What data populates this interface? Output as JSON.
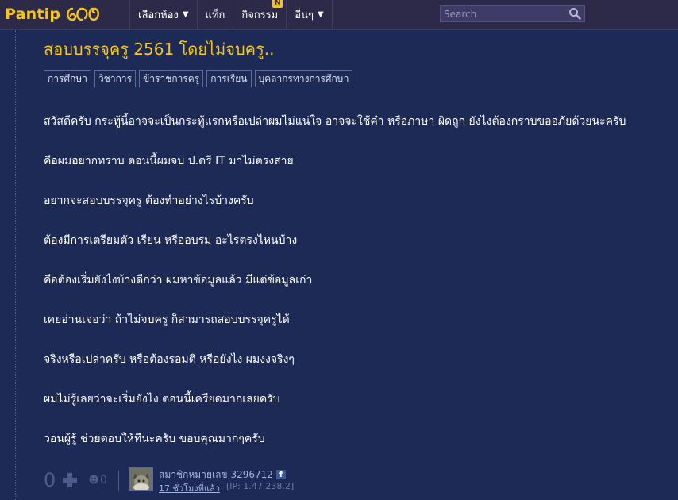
{
  "brand": {
    "name": "Pantip",
    "accent": "#f5c518"
  },
  "nav": {
    "items": [
      {
        "label": "เลือกห้อง",
        "dropdown": true
      },
      {
        "label": "แท็ก",
        "dropdown": false
      },
      {
        "label": "กิจกรรม",
        "dropdown": false,
        "badge": "N"
      },
      {
        "label": "อื่นๆ",
        "dropdown": true
      }
    ]
  },
  "search": {
    "placeholder": "Search",
    "icon": "search-icon"
  },
  "post": {
    "title": "สอบบรรจุครู 2561 โดยไม่จบครู..",
    "tags": [
      "การศึกษา",
      "วิชาการ",
      "ข้าราชการครู",
      "การเรียน",
      "บุคลากรทางการศึกษา"
    ],
    "body": [
      "สวัสดีครับ กระทู้นี้อาจจะเป็นกระทู้แรกหรือเปล่าผมไม่แน่ใจ อาจจะใช้คำ หรือภาษา ผิดถูก ยังไงต้องกราบขออภัยด้วยนะครับ",
      "คือผมอยากทราบ ตอนนี้ผมจบ ป.ตรี IT มาไม่ตรงสาย",
      "อยากจะสอบบรรจุครู ต้องทำอย่างไรบ้างครับ",
      "ต้องมีการเตรียมตัว เรียน หรืออบรม อะไรตรงไหนบ้าง",
      "คือต้องเริ่มยังไงบ้างดีกว่า ผมหาข้อมูลแล้ว มีแต่ข้อมูลเก่า",
      "เคยอ่านเจอว่า ถ้าไม่จบครู ก็สามารถสอบบรรจุครูได้",
      "จริงหรือเปล่าครับ หรือต้องรอมติ หรือยังไง ผมงงจริงๆ",
      "ผมไม่รู้เลยว่าจะเริ่มยังไง ตอนนี้เครียดมากเลยครับ",
      "วอนผู้รู้ ช่วยตอบให้ทีนะครับ ขอบคุณมากๆครับ"
    ],
    "footer": {
      "score": "0",
      "emotion_count": "0",
      "username": "สมาชิกหมายเลข 3296712",
      "time_ago": "17 ชั่วโมงที่แล้ว",
      "ip": "[IP: 1.47.238.2]"
    }
  }
}
